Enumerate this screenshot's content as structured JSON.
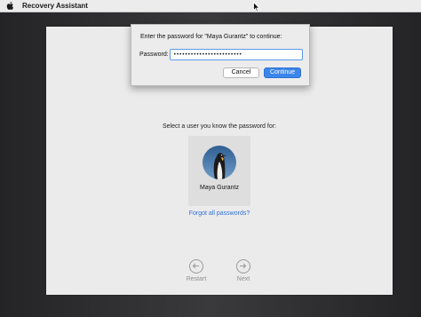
{
  "menubar": {
    "app_title": "Recovery Assistant"
  },
  "password_dialog": {
    "prompt": "Enter the password for \"Maya Gurantz\" to continue:",
    "password_label": "Password:",
    "password_value": "••••••••••••••••••••••••",
    "cancel_label": "Cancel",
    "continue_label": "Continue"
  },
  "user_picker": {
    "select_label": "Select a user you know the password for:",
    "user_name": "Maya Gurantz",
    "forgot_link": "Forgot all passwords?"
  },
  "navigation": {
    "restart_label": "Restart",
    "next_label": "Next"
  },
  "colors": {
    "accent": "#3b86ec",
    "link": "#2f6fd8",
    "panel_bg": "#ebebeb",
    "desktop_bg": "#2b2b2d"
  },
  "icons": [
    "apple-icon",
    "mouse-cursor-icon",
    "user-avatar-penguin",
    "restart-arrow-icon",
    "next-arrow-icon"
  ]
}
